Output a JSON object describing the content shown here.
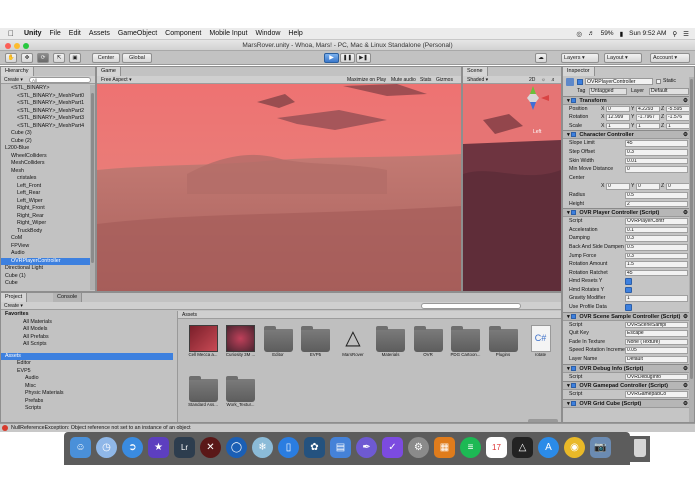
{
  "menubar": {
    "app": "Unity",
    "items": [
      "File",
      "Edit",
      "Assets",
      "GameObject",
      "Component",
      "Mobile Input",
      "Window",
      "Help"
    ],
    "battery": "59%",
    "datetime": "Sun 9:52 AM"
  },
  "window_title": "MarsRover.unity - Whoa, Mars! - PC, Mac & Linux Standalone (Personal)",
  "toolbar": {
    "center_label": "Center",
    "global_label": "Global",
    "layers_label": "Layers",
    "layout_label": "Layout",
    "account_label": "Account"
  },
  "hierarchy": {
    "tab": "Hierarchy",
    "create": "Create",
    "search_placeholder": "All",
    "items": [
      {
        "label": "<STL_BINARY>",
        "indent": 1
      },
      {
        "label": "<STL_BINARY>_MeshPart0",
        "indent": 2
      },
      {
        "label": "<STL_BINARY>_MeshPart1",
        "indent": 2
      },
      {
        "label": "<STL_BINARY>_MeshPart2",
        "indent": 2
      },
      {
        "label": "<STL_BINARY>_MeshPart3",
        "indent": 2
      },
      {
        "label": "<STL_BINARY>_MeshPart4",
        "indent": 2
      },
      {
        "label": "Cube (3)",
        "indent": 1
      },
      {
        "label": "Cube (2)",
        "indent": 1
      },
      {
        "label": "L200-Blue",
        "indent": 0
      },
      {
        "label": "WheelColliders",
        "indent": 1
      },
      {
        "label": "MeshColliders",
        "indent": 1
      },
      {
        "label": "Mesh",
        "indent": 1
      },
      {
        "label": "cristales",
        "indent": 2
      },
      {
        "label": "Left_Front",
        "indent": 2
      },
      {
        "label": "Left_Rear",
        "indent": 2
      },
      {
        "label": "Left_Wiper",
        "indent": 2
      },
      {
        "label": "Right_Front",
        "indent": 2
      },
      {
        "label": "Right_Rear",
        "indent": 2
      },
      {
        "label": "Right_Wiper",
        "indent": 2
      },
      {
        "label": "TruckBody",
        "indent": 2
      },
      {
        "label": "CoM",
        "indent": 1
      },
      {
        "label": "FPView",
        "indent": 1
      },
      {
        "label": "Audio",
        "indent": 1
      },
      {
        "label": "OVRPlayerController",
        "indent": 1
      },
      {
        "label": "Directional Light",
        "indent": 0
      },
      {
        "label": "Cube (1)",
        "indent": 0
      },
      {
        "label": "Cube",
        "indent": 0
      }
    ],
    "selected_index": 23
  },
  "game": {
    "tab": "Game",
    "aspect": "Free Aspect",
    "options": [
      "Maximize on Play",
      "Mute audio",
      "Stats",
      "Gizmos"
    ]
  },
  "scene": {
    "tab": "Scene",
    "shading": "Shaded",
    "mode_2d": "2D",
    "gizmo_label": "Left"
  },
  "inspector": {
    "tab": "Inspector",
    "object_name": "OVRPlayerController",
    "static_label": "Static",
    "tag_label": "Tag",
    "tag_value": "Untagged",
    "layer_label": "Layer",
    "layer_value": "Default",
    "transform": {
      "title": "Transform",
      "rows": [
        {
          "label": "Position",
          "x": "0",
          "y": "4.2293",
          "z": "-5.595"
        },
        {
          "label": "Rotation",
          "x": "12.999",
          "y": "-1.7967",
          "z": "-1.576"
        },
        {
          "label": "Scale",
          "x": "1",
          "y": "1",
          "z": "1"
        }
      ]
    },
    "character_controller": {
      "title": "Character Controller",
      "rows": [
        {
          "label": "Slope Limit",
          "value": "45"
        },
        {
          "label": "Step Offset",
          "value": "0.3"
        },
        {
          "label": "Skin Width",
          "value": "0.01"
        },
        {
          "label": "Min Move Distance",
          "value": "0"
        },
        {
          "label": "Center",
          "value": ""
        }
      ],
      "center": {
        "x": "0",
        "y": "0",
        "z": "0"
      },
      "rows2": [
        {
          "label": "Radius",
          "value": "0.5"
        },
        {
          "label": "Height",
          "value": "2"
        }
      ]
    },
    "ovr_player": {
      "title": "OVR Player Controller (Script)",
      "rows": [
        {
          "label": "Script",
          "value": "OVRPlayerContr",
          "kind": "field"
        },
        {
          "label": "Acceleration",
          "value": "0.1",
          "kind": "field"
        },
        {
          "label": "Damping",
          "value": "0.3",
          "kind": "field"
        },
        {
          "label": "Back And Side Dampen",
          "value": "0.5",
          "kind": "field"
        },
        {
          "label": "Jump Force",
          "value": "0.3",
          "kind": "field"
        },
        {
          "label": "Rotation Amount",
          "value": "1.5",
          "kind": "field"
        },
        {
          "label": "Rotation Ratchet",
          "value": "45",
          "kind": "field"
        },
        {
          "label": "Hmd Resets Y",
          "value": "",
          "kind": "check"
        },
        {
          "label": "Hmd Rotates Y",
          "value": "",
          "kind": "check"
        },
        {
          "label": "Gravity Modifier",
          "value": "1",
          "kind": "field"
        },
        {
          "label": "Use Profile Data",
          "value": "",
          "kind": "check"
        }
      ]
    },
    "ovr_scene_sample": {
      "title": "OVR Scene Sample Controller (Script)",
      "rows": [
        {
          "label": "Script",
          "value": "OVRSceneSampl",
          "kind": "field"
        },
        {
          "label": "Quit Key",
          "value": "Escape",
          "kind": "field"
        },
        {
          "label": "Fade In Texture",
          "value": "None (Texture)",
          "kind": "field"
        },
        {
          "label": "Speed Rotation Increment",
          "value": "0.05",
          "kind": "field"
        },
        {
          "label": "Layer Name",
          "value": "Default",
          "kind": "field"
        }
      ]
    },
    "ovr_debug": {
      "title": "OVR Debug Info (Script)",
      "rows": [
        {
          "label": "Script",
          "value": "OVRDebugInfo",
          "kind": "field"
        }
      ]
    },
    "ovr_gamepad": {
      "title": "OVR Gamepad Controller (Script)",
      "rows": [
        {
          "label": "Script",
          "value": "OVRGamepadCo",
          "kind": "field"
        }
      ]
    },
    "ovr_grid": {
      "title": "OVR Grid Cube (Script)"
    }
  },
  "project": {
    "tab": "Project",
    "console_tab": "Console",
    "create": "Create",
    "favorites_title": "Favorites",
    "favorites": [
      "All Materials",
      "All Models",
      "All Prefabs",
      "All Scripts"
    ],
    "assets_title": "Assets",
    "tree": [
      {
        "label": "Editor",
        "indent": 1
      },
      {
        "label": "EVP5",
        "indent": 1
      },
      {
        "label": "Audio",
        "indent": 2
      },
      {
        "label": "Misc",
        "indent": 2
      },
      {
        "label": "Physic Materials",
        "indent": 2
      },
      {
        "label": "Prefabs",
        "indent": 2
      },
      {
        "label": "Scripts",
        "indent": 2
      }
    ],
    "breadcrumb": "Assets",
    "items_row1": [
      {
        "label": "Cell Mecca a...",
        "kind": "book"
      },
      {
        "label": "Curiosity 3M ...",
        "kind": "rover"
      },
      {
        "label": "Editor",
        "kind": "folder"
      },
      {
        "label": "EVP5",
        "kind": "folder"
      },
      {
        "label": "MarsRover",
        "kind": "unity"
      },
      {
        "label": "Materials",
        "kind": "folder"
      },
      {
        "label": "OVR",
        "kind": "folder"
      },
      {
        "label": "PDG Cartoon...",
        "kind": "folder"
      },
      {
        "label": "Plugins",
        "kind": "folder"
      },
      {
        "label": "rotate",
        "kind": "cs"
      }
    ],
    "items_row2": [
      {
        "label": "Standard Ass...",
        "kind": "folder"
      },
      {
        "label": "Work_Textur...",
        "kind": "folder"
      }
    ]
  },
  "status_message": "NullReferenceException: Object reference not set to an instance of an object",
  "colors": {
    "game_sky": "#ea7373",
    "game_ground": "#b96a66",
    "selection": "#3d80df",
    "panel_bg": "#c2c2c2"
  }
}
